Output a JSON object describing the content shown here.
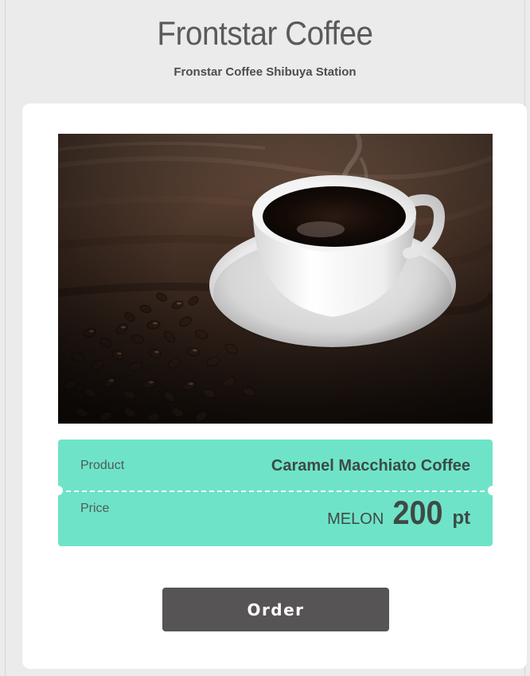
{
  "header": {
    "title": "Frontstar Coffee",
    "subtitle": "Fronstar Coffee Shibuya Station"
  },
  "product": {
    "image_icon": "coffee-cup-photo",
    "product_label": "Product",
    "product_name": "Caramel Macchiato Coffee",
    "price_label": "Price",
    "price_currency": "MELON",
    "price_amount": "200",
    "price_unit": "pt"
  },
  "actions": {
    "order_label": "Order"
  },
  "colors": {
    "background": "#ebebeb",
    "card": "#ffffff",
    "info_panel": "#6fe3c8",
    "button": "#565454",
    "text": "#555555"
  }
}
